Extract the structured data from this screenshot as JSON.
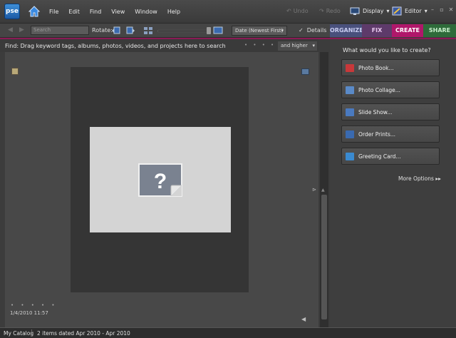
{
  "app": {
    "logo_text": "pse"
  },
  "menu": [
    "File",
    "Edit",
    "Find",
    "View",
    "Window",
    "Help"
  ],
  "header": {
    "undo_label": "Undo",
    "redo_label": "Redo",
    "display_label": "Display",
    "editor_label": "Editor"
  },
  "toolbar": {
    "search_placeholder": "Search",
    "rotate_label": "Rotate:",
    "sort_value": "Date (Newest First)",
    "details_label": "Details",
    "details_checked": true
  },
  "tabs": [
    {
      "label": "ORGANIZE"
    },
    {
      "label": "FIX"
    },
    {
      "label": "CREATE"
    },
    {
      "label": "SHARE"
    }
  ],
  "findbar": {
    "text": "Find: Drag keyword tags, albums, photos, videos, and projects here to search",
    "rating_filter": "and higher"
  },
  "browser": {
    "item_date": "1/4/2010 11:57"
  },
  "panel": {
    "title": "What would you like to create?",
    "buttons": [
      {
        "label": "Photo Book...",
        "icon": "photo-book-icon",
        "color": "#c8383a"
      },
      {
        "label": "Photo Collage...",
        "icon": "photo-collage-icon",
        "color": "#5a8ac8"
      },
      {
        "label": "Slide Show...",
        "icon": "slide-show-icon",
        "color": "#4a7ac0"
      },
      {
        "label": "Order Prints...",
        "icon": "order-prints-icon",
        "color": "#3a6ab0"
      },
      {
        "label": "Greeting Card...",
        "icon": "greeting-card-icon",
        "color": "#3a8ad0"
      }
    ],
    "more_options": "More Options"
  },
  "status": {
    "catalog": "My Catalog",
    "items": "2 items dated Apr 2010 - Apr 2010"
  }
}
